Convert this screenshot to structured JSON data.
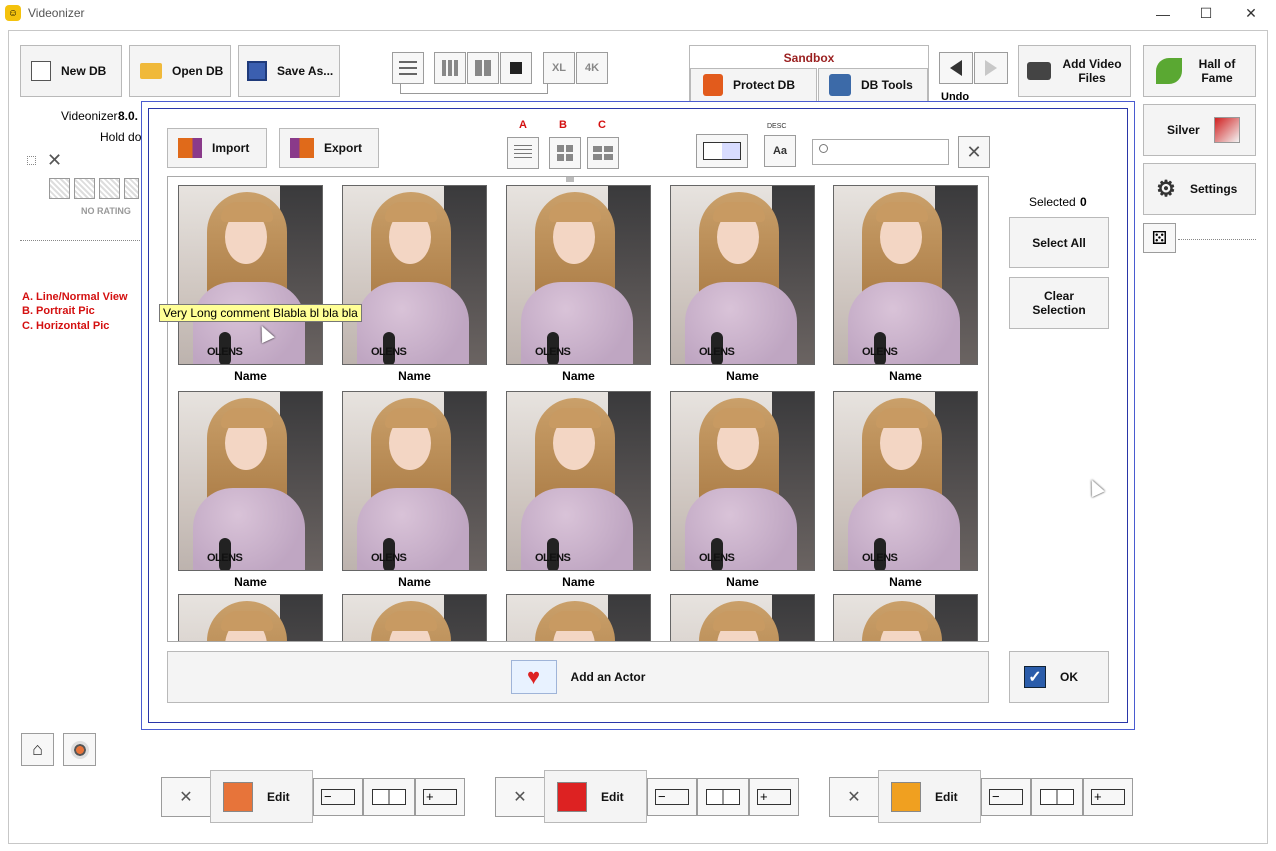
{
  "window": {
    "title": "Videonizer",
    "minimize": "—",
    "maximize": "☐",
    "close": "✕"
  },
  "toolbar": {
    "new_db": "New DB",
    "open_db": "Open DB",
    "save_as": "Save As...",
    "view_xl": "XL",
    "view_4k": "4K",
    "sandbox_label": "Sandbox",
    "protect_db": "Protect DB",
    "db_tools": "DB Tools",
    "undo": "Undo",
    "add_video_files": "Add Video Files",
    "hall_of_fame": "Hall of Fame",
    "silver": "Silver",
    "settings": "Settings",
    "x_button": "x"
  },
  "left_panel": {
    "app_name": "Videonizer",
    "version_fragment": "8.0.",
    "hold_fragment": "Hold dov",
    "no_rating": "NO RATING",
    "legend": [
      "A. Line/Normal View",
      "B. Portrait Pic",
      "C. Horizontal Pic"
    ]
  },
  "dialog": {
    "import": "Import",
    "export": "Export",
    "view_labels": [
      "A",
      "B",
      "C"
    ],
    "sort_label": "DESC",
    "search_placeholder": "",
    "selected_label": "Selected",
    "selected_count": "0",
    "select_all": "Select All",
    "clear_selection": "Clear Selection",
    "add_actor": "Add an Actor",
    "ok": "OK",
    "tooltip": "Very Long comment Blabla bl bla bla",
    "card_name": "Name",
    "watermark": "OLENS"
  },
  "bottom_bar": {
    "edit_label": "Edit"
  }
}
